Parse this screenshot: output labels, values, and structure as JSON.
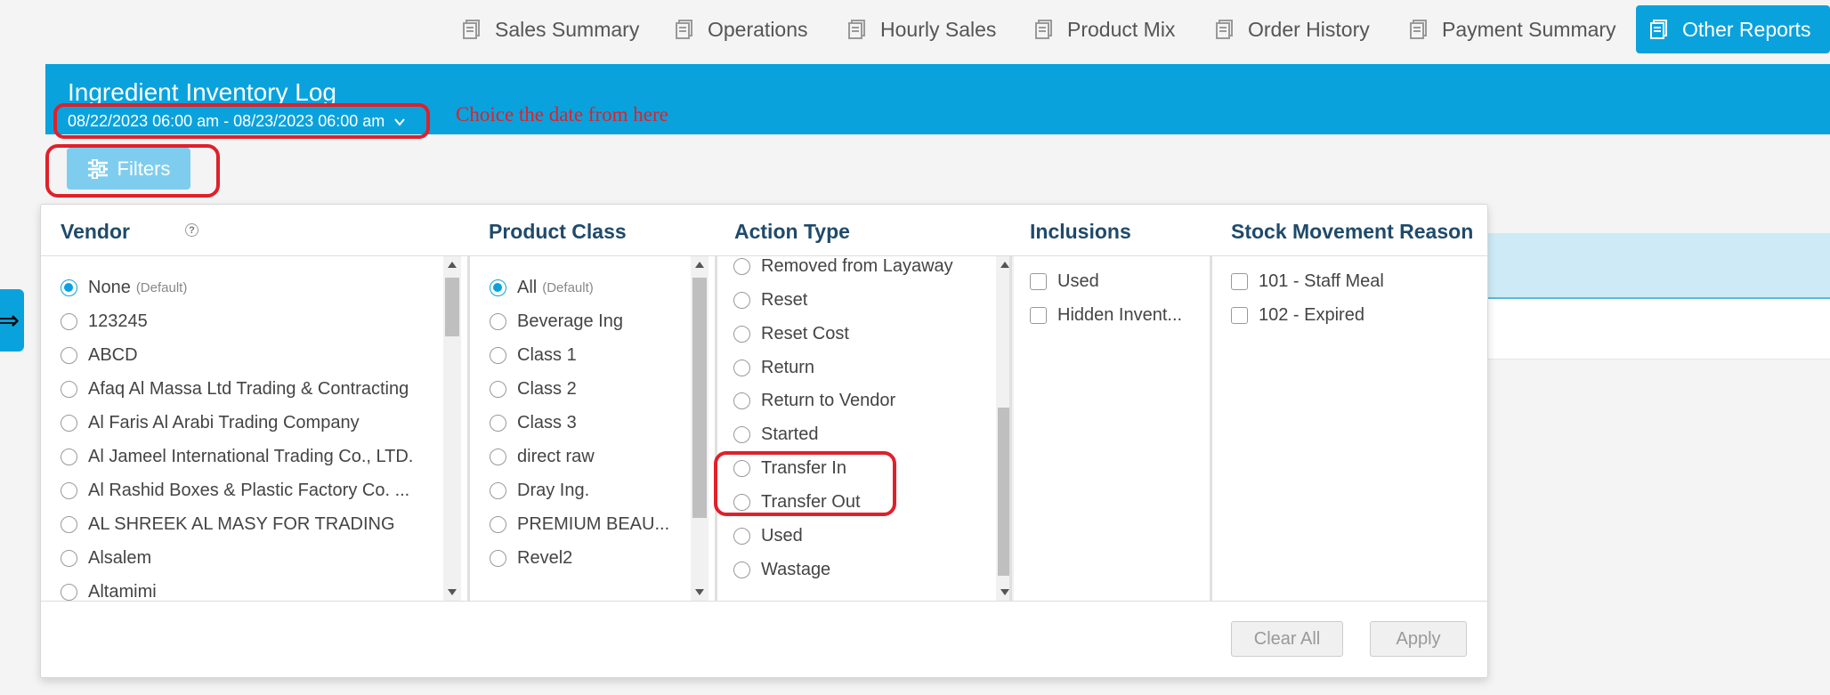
{
  "nav": {
    "tabs": [
      {
        "label": "Sales Summary",
        "active": false
      },
      {
        "label": "Operations",
        "active": false
      },
      {
        "label": "Hourly Sales",
        "active": false
      },
      {
        "label": "Product Mix",
        "active": false
      },
      {
        "label": "Order History",
        "active": false
      },
      {
        "label": "Payment Summary",
        "active": false
      },
      {
        "label": "Other Reports",
        "active": true
      }
    ]
  },
  "report": {
    "title": "Ingredient Inventory Log",
    "date_range": "08/22/2023 06:00 am - 08/23/2023 06:00 am",
    "annotation": "Choice the date from here"
  },
  "filters_button": {
    "label": "Filters"
  },
  "panel": {
    "vendor": {
      "title": "Vendor",
      "help": "?",
      "options": [
        {
          "label": "None",
          "suffix": "(Default)",
          "selected": true
        },
        {
          "label": "123245"
        },
        {
          "label": "ABCD"
        },
        {
          "label": "Afaq Al Massa Ltd Trading & Contracting"
        },
        {
          "label": "Al Faris Al Arabi Trading Company"
        },
        {
          "label": "Al Jameel International Trading Co., LTD."
        },
        {
          "label": "Al Rashid Boxes & Plastic Factory Co. ..."
        },
        {
          "label": "AL SHREEK AL MASY FOR TRADING"
        },
        {
          "label": "Alsalem"
        },
        {
          "label": "Altamimi"
        }
      ]
    },
    "product_class": {
      "title": "Product Class",
      "options": [
        {
          "label": "All",
          "suffix": "(Default)",
          "selected": true
        },
        {
          "label": "Beverage Ing"
        },
        {
          "label": "Class 1"
        },
        {
          "label": "Class 2"
        },
        {
          "label": "Class 3"
        },
        {
          "label": "direct raw"
        },
        {
          "label": "Dray Ing."
        },
        {
          "label": "PREMIUM BEAU..."
        },
        {
          "label": "Revel2"
        }
      ]
    },
    "action_type": {
      "title": "Action Type",
      "options": [
        {
          "label": "Removed from Layaway"
        },
        {
          "label": "Reset"
        },
        {
          "label": "Reset Cost"
        },
        {
          "label": "Return"
        },
        {
          "label": "Return to Vendor"
        },
        {
          "label": "Started"
        },
        {
          "label": "Transfer In"
        },
        {
          "label": "Transfer Out"
        },
        {
          "label": "Used"
        },
        {
          "label": "Wastage"
        }
      ]
    },
    "inclusions": {
      "title": "Inclusions",
      "options": [
        {
          "label": "Used"
        },
        {
          "label": "Hidden Invent..."
        }
      ]
    },
    "stock_reason": {
      "title": "Stock Movement Reason",
      "options": [
        {
          "label": "101 - Staff Meal"
        },
        {
          "label": "102 - Expired"
        }
      ]
    },
    "clear_all": "Clear All",
    "apply": "Apply"
  },
  "colors": {
    "accent": "#0aa2dc",
    "highlight": "#e0202a",
    "heading": "#1f4a6b"
  }
}
